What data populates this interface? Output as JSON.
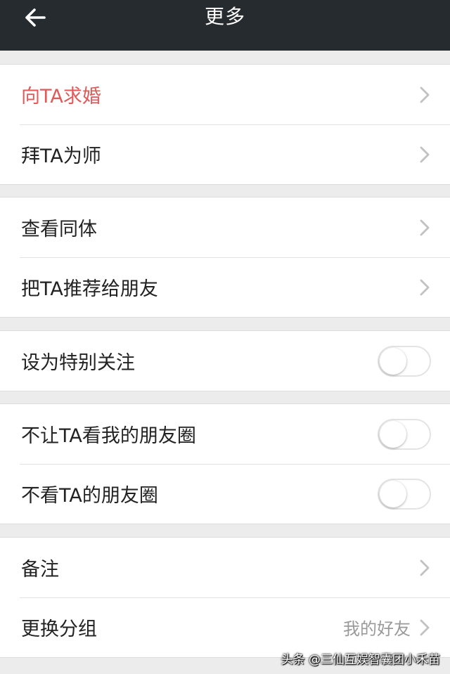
{
  "header": {
    "title": "更多",
    "back_icon": "arrow-left-icon"
  },
  "colors": {
    "header_bg": "#262b2f",
    "accent": "#e05a5a",
    "background": "#ececec"
  },
  "groups": [
    {
      "rows": [
        {
          "label": "向TA求婚",
          "type": "link",
          "accent": true
        },
        {
          "label": "拜TA为师",
          "type": "link"
        }
      ]
    },
    {
      "rows": [
        {
          "label": "查看同体",
          "type": "link"
        },
        {
          "label": "把TA推荐给朋友",
          "type": "link"
        }
      ]
    },
    {
      "rows": [
        {
          "label": "设为特别关注",
          "type": "toggle",
          "on": false
        }
      ]
    },
    {
      "rows": [
        {
          "label": "不让TA看我的朋友圈",
          "type": "toggle",
          "on": false
        },
        {
          "label": "不看TA的朋友圈",
          "type": "toggle",
          "on": false
        }
      ]
    },
    {
      "rows": [
        {
          "label": "备注",
          "type": "link"
        },
        {
          "label": "更换分组",
          "type": "link",
          "value": "我的好友"
        }
      ]
    }
  ],
  "watermark": "头条 @三仙互娱智囊团小禾苗"
}
